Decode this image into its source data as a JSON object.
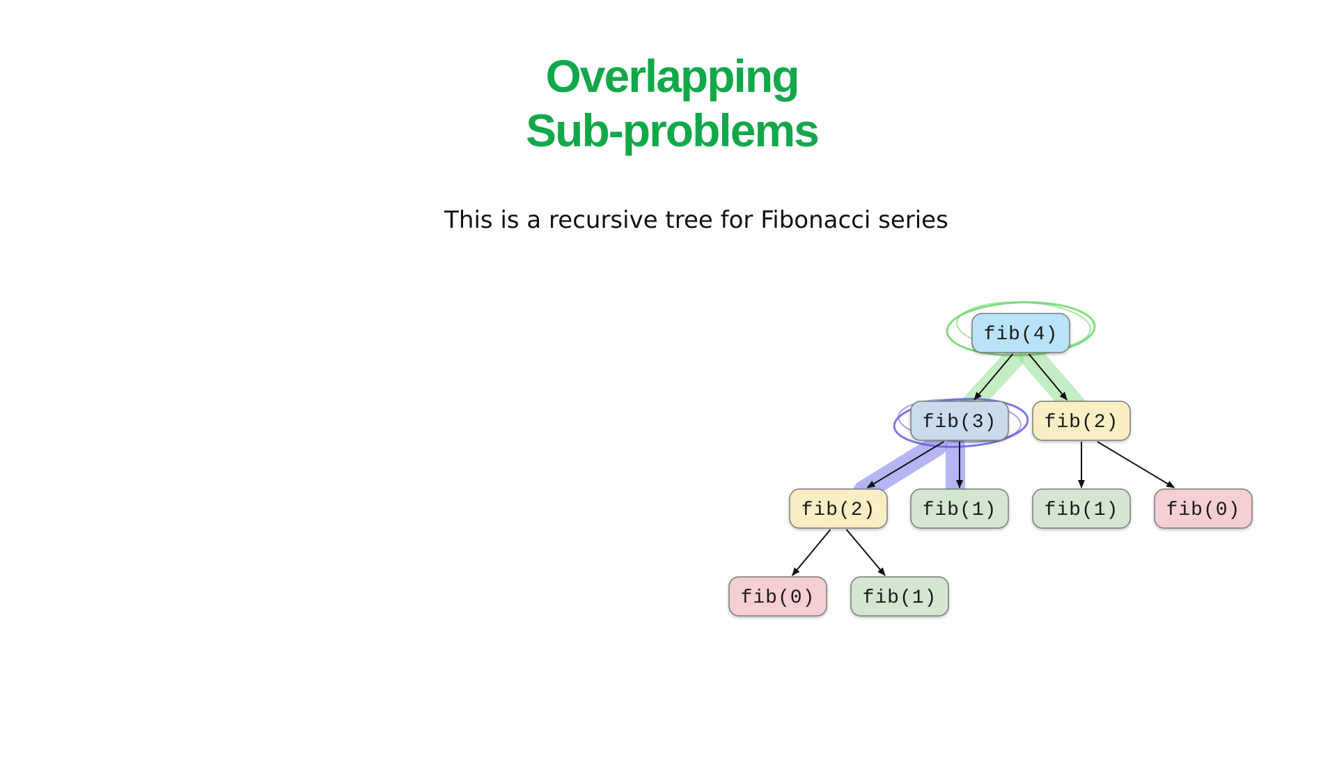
{
  "slide": {
    "title_line1": "Overlapping",
    "title_line2": "Sub-problems",
    "subtitle": "This is a recursive tree for Fibonacci series"
  },
  "colors": {
    "title": "#12a84a",
    "blue_node": "#b9e3f9",
    "steel_node": "#c9dbec",
    "yellow_node": "#fbeec4",
    "green_node": "#d4e6d2",
    "red_node": "#f6cfd2",
    "green_highlight": "#7cd77a",
    "blue_highlight": "#5b5be6"
  },
  "tree": {
    "nodes": [
      {
        "id": "n4",
        "label": "fib(4)",
        "color": "blue_node"
      },
      {
        "id": "n3",
        "label": "fib(3)",
        "color": "steel_node"
      },
      {
        "id": "n2a",
        "label": "fib(2)",
        "color": "yellow_node"
      },
      {
        "id": "n2b",
        "label": "fib(2)",
        "color": "yellow_node"
      },
      {
        "id": "n1a",
        "label": "fib(1)",
        "color": "green_node"
      },
      {
        "id": "n1b",
        "label": "fib(1)",
        "color": "green_node"
      },
      {
        "id": "n0a",
        "label": "fib(0)",
        "color": "red_node"
      },
      {
        "id": "n0b",
        "label": "fib(0)",
        "color": "red_node"
      },
      {
        "id": "n1c",
        "label": "fib(1)",
        "color": "green_node"
      }
    ],
    "edges": [
      {
        "from": "n4",
        "to": "n3"
      },
      {
        "from": "n4",
        "to": "n2b"
      },
      {
        "from": "n3",
        "to": "n2a"
      },
      {
        "from": "n3",
        "to": "n1a"
      },
      {
        "from": "n2b",
        "to": "n1b"
      },
      {
        "from": "n2b",
        "to": "n0b"
      },
      {
        "from": "n2a",
        "to": "n0a"
      },
      {
        "from": "n2a",
        "to": "n1c"
      }
    ]
  }
}
